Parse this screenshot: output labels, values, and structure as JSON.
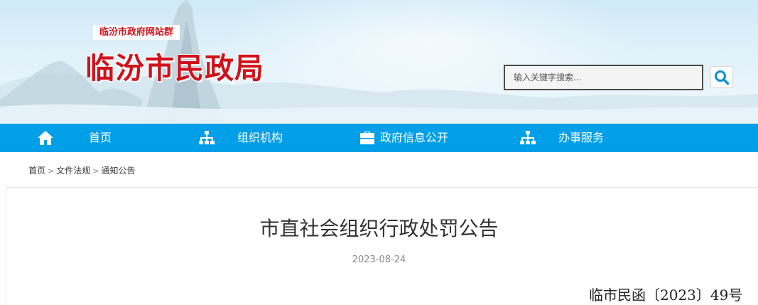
{
  "header": {
    "site_group": "临汾市政府网站群",
    "site_title": "临汾市民政局"
  },
  "search": {
    "placeholder": "输入关键字搜索..."
  },
  "nav": {
    "items": [
      {
        "label": "首页",
        "icon": "home-icon"
      },
      {
        "label": "组织机构",
        "icon": "org-chart-icon"
      },
      {
        "label": "政府信息公开",
        "icon": "briefcase-icon"
      },
      {
        "label": "办事服务",
        "icon": "org-chart-icon"
      }
    ]
  },
  "breadcrumb": {
    "items": [
      "首页",
      "文件法规",
      "通知公告"
    ],
    "separator": ">"
  },
  "article": {
    "title": "市直社会组织行政处罚公告",
    "date": "2023-08-24",
    "doc_number": "临市民函〔2023〕49号"
  },
  "colors": {
    "brand_red": "#d0121b",
    "nav_blue": "#009fe8",
    "search_icon_blue": "#0a8fd8"
  }
}
